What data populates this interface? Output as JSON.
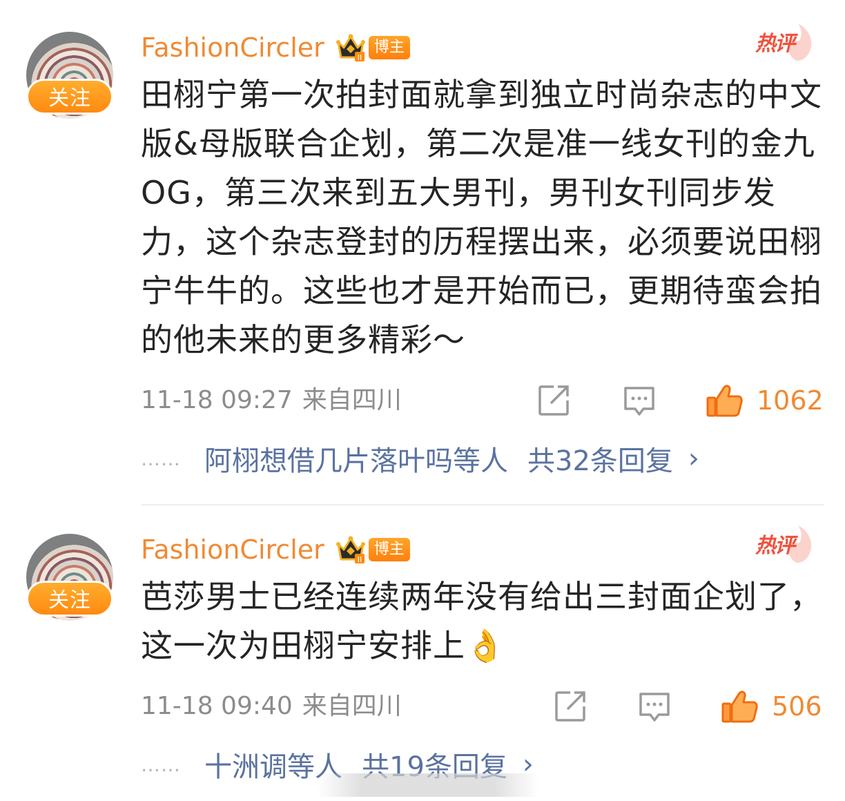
{
  "comments": [
    {
      "username": "FashionCircler",
      "badge": "博主",
      "follow_label": "关注",
      "hot_label": "热评",
      "content": "田栩宁第一次拍封面就拿到独立时尚杂志的中文版&母版联合企划，第二次是准一线女刊的金九OG，第三次来到五大男刊，男刊女刊同步发力，这个杂志登封的历程摆出来，必须要说田栩宁牛牛的。这些也才是开始而已，更期待蛮会拍的他未来的更多精彩～",
      "time": "11-18 09:27",
      "location": "来自四川",
      "likes": "1062",
      "reply_dots": "……",
      "reply_names": "阿栩想借几片落叶吗等人",
      "reply_total": "共32条回复",
      "chevron": "›"
    },
    {
      "username": "FashionCircler",
      "badge": "博主",
      "follow_label": "关注",
      "hot_label": "热评",
      "content": "芭莎男士已经连续两年没有给出三封面企划了，这一次为田栩宁安排上👌",
      "time": "11-18 09:40",
      "location": "来自四川",
      "likes": "506",
      "reply_dots": "……",
      "reply_names": "十洲调等人",
      "reply_total": "共19条回复",
      "chevron": "›"
    }
  ],
  "icons": {
    "share": "share-icon",
    "comment": "comment-icon",
    "like": "thumbs-up-icon",
    "crown": "crown-icon"
  },
  "colors": {
    "accent_orange": "#f08a33",
    "hot_red": "#f0513d",
    "reply_blue": "#5b72a0",
    "meta_gray": "#8c8c8c"
  }
}
